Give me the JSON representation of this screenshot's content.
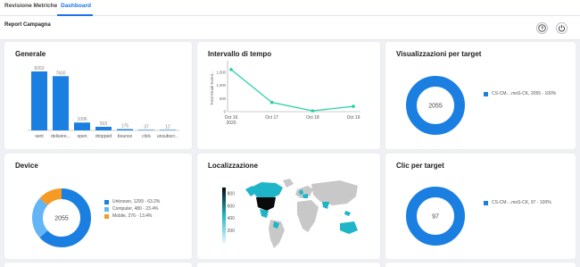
{
  "tabs": [
    {
      "label": "Revisione Metriche"
    },
    {
      "label": "Dashboard"
    }
  ],
  "page_title": "Report Campagna",
  "header_icons": [
    "help-icon",
    "power-icon"
  ],
  "colors": {
    "accent": "#1a73e8",
    "chart_blue": "#1a7fe0",
    "teal": "#26d0a6",
    "orange": "#f59a23",
    "light_blue": "#64b5f6",
    "map_teal": "#1fb5c9",
    "map_dark": "#0a0a0a",
    "map_grey": "#c8c8c8"
  },
  "cards": {
    "generale": {
      "title": "Generale"
    },
    "intervallo": {
      "title": "Intervallo di tempo"
    },
    "visualizzazioni": {
      "title": "Visualizzazioni per target"
    },
    "device": {
      "title": "Device"
    },
    "localizzazione": {
      "title": "Localizzazione"
    },
    "clic": {
      "title": "Clic per target"
    }
  },
  "chart_data": [
    {
      "id": "generale",
      "type": "bar",
      "title": "Generale",
      "categories": [
        "sent",
        "delivere...",
        "open",
        "dropped",
        "bounce",
        "click",
        "unsubscr..."
      ],
      "values": [
        8263,
        7600,
        1096,
        503,
        175,
        37,
        12
      ],
      "value_labels": [
        "8263",
        "7600",
        "1096",
        "503",
        "175",
        "37",
        "12"
      ],
      "ylim": [
        0,
        8263
      ]
    },
    {
      "id": "intervallo",
      "type": "line",
      "title": "Intervallo di tempo",
      "ylabel": "Total Email Event...",
      "x": [
        "Oct 16 2020",
        "Oct 17",
        "Oct 18",
        "Oct 19"
      ],
      "x_tick_lines": [
        [
          "Oct 16",
          "2020"
        ],
        [
          "Oct 17"
        ],
        [
          "Oct 18"
        ],
        [
          "Oct 19"
        ]
      ],
      "values": [
        1600,
        350,
        30,
        200
      ],
      "ylim": [
        0,
        1800
      ],
      "yticks": [
        "1,500",
        "1,000",
        "500",
        "0"
      ],
      "ytick_values": [
        1500,
        1000,
        500,
        0
      ]
    },
    {
      "id": "visualizzazioni",
      "type": "pie",
      "title": "Visualizzazioni per target",
      "center_label": "2055",
      "slices": [
        {
          "label": "CS-CM-...moS-CK, 2055 - 100%",
          "value": 2055,
          "color": "#1a7fe0"
        }
      ]
    },
    {
      "id": "device",
      "type": "pie",
      "title": "Device",
      "center_label": "2055",
      "slices": [
        {
          "label": "Unknown, 1299 - 63.2%",
          "value": 1299,
          "color": "#1a7fe0"
        },
        {
          "label": "Computer, 480 - 23.4%",
          "value": 480,
          "color": "#64b5f6"
        },
        {
          "label": "Mobile, 276 - 13.4%",
          "value": 276,
          "color": "#f59a23"
        }
      ]
    },
    {
      "id": "localizzazione",
      "type": "heatmap",
      "title": "Localizzazione",
      "scale_ticks": [
        "800",
        "600",
        "400",
        "200"
      ],
      "scale_values": [
        800,
        600,
        400,
        200
      ]
    },
    {
      "id": "clic",
      "type": "pie",
      "title": "Clic per target",
      "center_label": "97",
      "slices": [
        {
          "label": "CS-CM-...moS-CK, 97 - 100%",
          "value": 97,
          "color": "#1a7fe0"
        }
      ]
    }
  ]
}
